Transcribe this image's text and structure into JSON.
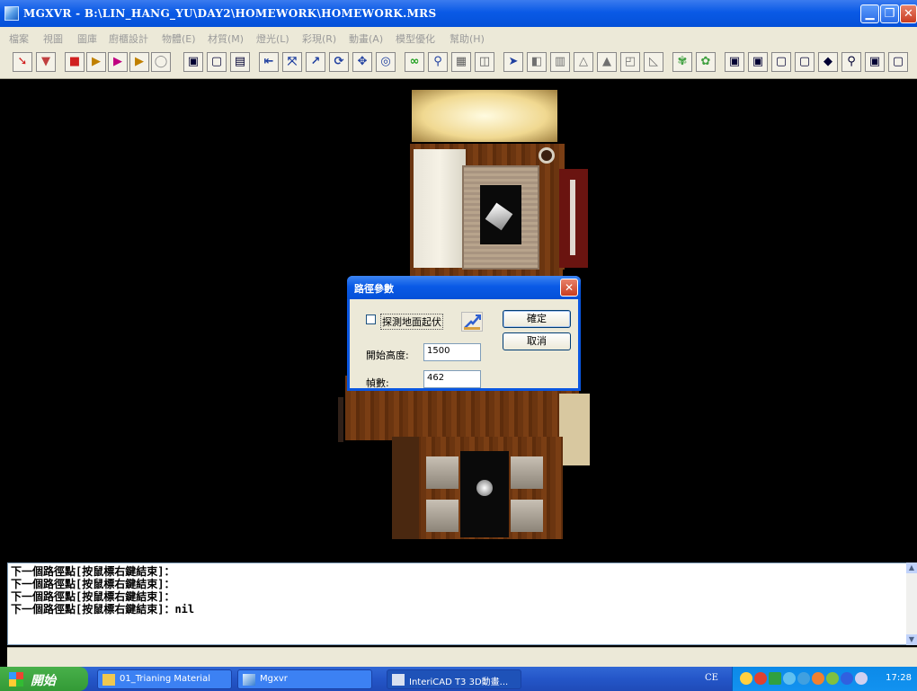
{
  "window": {
    "title": "MGXVR - B:\\LIN_HANG_YU\\DAY2\\HOMEWORK\\HOMEWORK.MRS"
  },
  "menu": [
    "檔案",
    "視圖",
    "圖庫",
    "廚櫃設計",
    "物體(E)",
    "材質(M)",
    "燈光(L)",
    "彩現(R)",
    "動畫(A)",
    "模型優化",
    "幫助(H)"
  ],
  "dialog": {
    "title": "路徑參數",
    "checkbox_label": "探測地面起伏",
    "start_height_label": "開始高度:",
    "start_height_value": "1500",
    "frames_label": "幀數:",
    "frames_value": "462",
    "ok_label": "確定",
    "cancel_label": "取消"
  },
  "command_lines": [
    "下一個路徑點[按鼠標右鍵結束]：",
    "下一個路徑點[按鼠標右鍵結束]：",
    "下一個路徑點[按鼠標右鍵結束]：",
    "下一個路徑點[按鼠標右鍵結束]：nil"
  ],
  "taskbar": {
    "start_label": "開始",
    "tasks": [
      "01_Trianing Material",
      "Mgxvr",
      "InteriCAD T3 3D動畫..."
    ],
    "language": "CE",
    "clock": "17:28"
  },
  "colors": {
    "titlebar": "#0a5ae6",
    "chrome": "#ece9d8",
    "floor": "#6b3510"
  }
}
